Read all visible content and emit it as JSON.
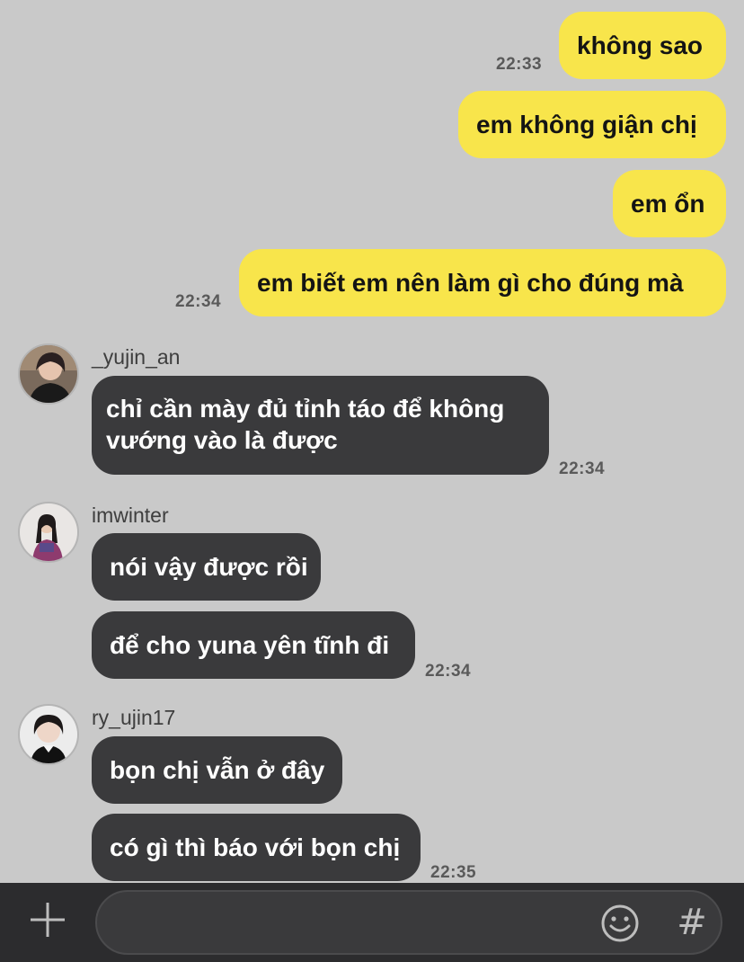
{
  "theme": {
    "chat_background": "#c9c9c9",
    "outgoing_bubble": "#f8e54b",
    "incoming_bubble": "#3a3a3c",
    "composer_background": "#2c2c2e"
  },
  "outgoing": {
    "messages": [
      "không sao",
      "em không giận chị",
      "em ổn",
      "em biết em nên làm gì cho đúng mà"
    ],
    "times": [
      "22:33",
      "22:34"
    ]
  },
  "groups": [
    {
      "sender": "_yujin_an",
      "avatar": "avatar-yujin-an",
      "messages": [
        "chỉ cần mày đủ tỉnh táo để không vướng vào là được"
      ],
      "time": "22:34"
    },
    {
      "sender": "imwinter",
      "avatar": "avatar-imwinter",
      "messages": [
        "nói vậy được rồi",
        "để cho yuna yên tĩnh đi"
      ],
      "time": "22:34"
    },
    {
      "sender": "ry_ujin17",
      "avatar": "avatar-ry-ujin17",
      "messages": [
        "bọn chị vẫn ở đây",
        "có gì thì báo với bọn chị"
      ],
      "time": "22:35"
    }
  ],
  "composer": {
    "input_value": "",
    "plus_icon": "plus-icon",
    "emoji_icon": "smiley-icon",
    "hash_label": "#"
  }
}
